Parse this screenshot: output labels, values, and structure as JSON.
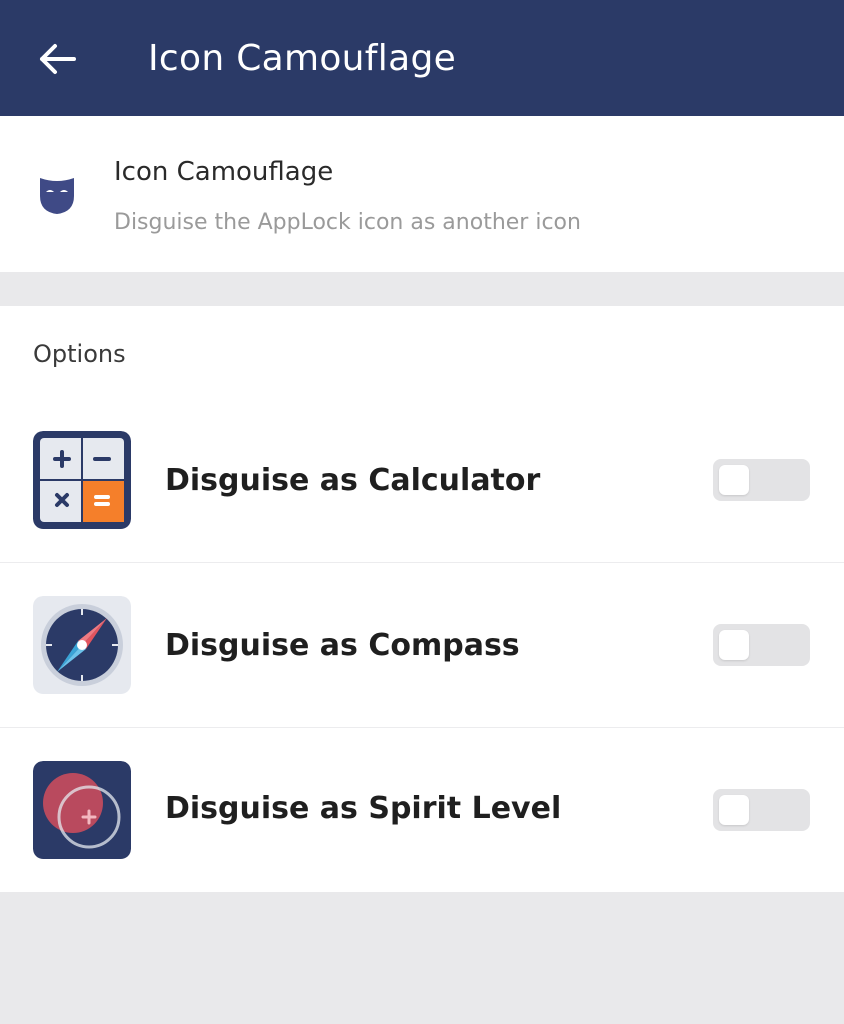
{
  "appbar": {
    "title": "Icon Camouflage",
    "back_icon": "arrow-left-icon",
    "background": "#2b3a67"
  },
  "header": {
    "icon": "mask-icon",
    "title": "Icon Camouflage",
    "subtitle": "Disguise the AppLock icon as another icon"
  },
  "options": {
    "label": "Options",
    "items": [
      {
        "label": "Disguise as Calculator",
        "icon": "calculator-icon",
        "enabled": false
      },
      {
        "label": "Disguise as Compass",
        "icon": "compass-icon",
        "enabled": false
      },
      {
        "label": "Disguise as Spirit Level",
        "icon": "spirit-level-icon",
        "enabled": false
      }
    ]
  },
  "colors": {
    "primary": "#2b3a67",
    "accent_orange": "#f57f2a",
    "accent_red": "#e2545e"
  }
}
